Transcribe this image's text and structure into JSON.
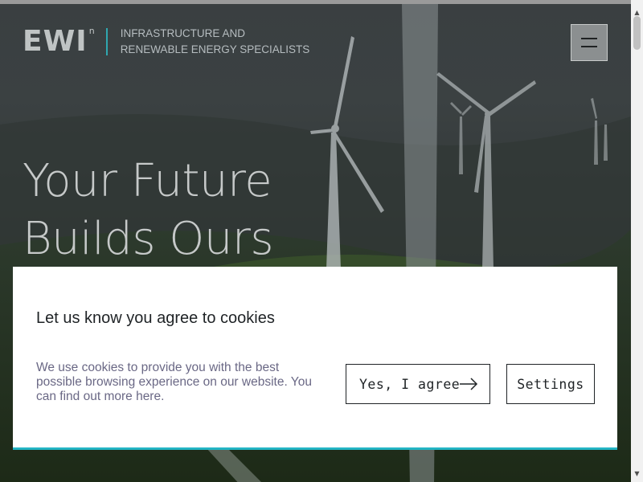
{
  "header": {
    "logo_text": "EWI",
    "logo_reg": "n",
    "tagline_line1": "INFRASTRUCTURE AND",
    "tagline_line2": "RENEWABLE ENERGY SPECIALISTS"
  },
  "hero": {
    "headline_line1": "Your Future",
    "headline_line2": "Builds Ours"
  },
  "cookie_banner": {
    "title": "Let us know you agree to cookies",
    "description": "We use cookies to provide you with the best possible browsing experience on our website. You can find out more here.",
    "agree_label": "Yes, I agree",
    "settings_label": "Settings",
    "accent_color": "#23b5c4"
  },
  "icons": {
    "menu": "hamburger-icon",
    "agree_arrow": "arrow-right-icon"
  }
}
